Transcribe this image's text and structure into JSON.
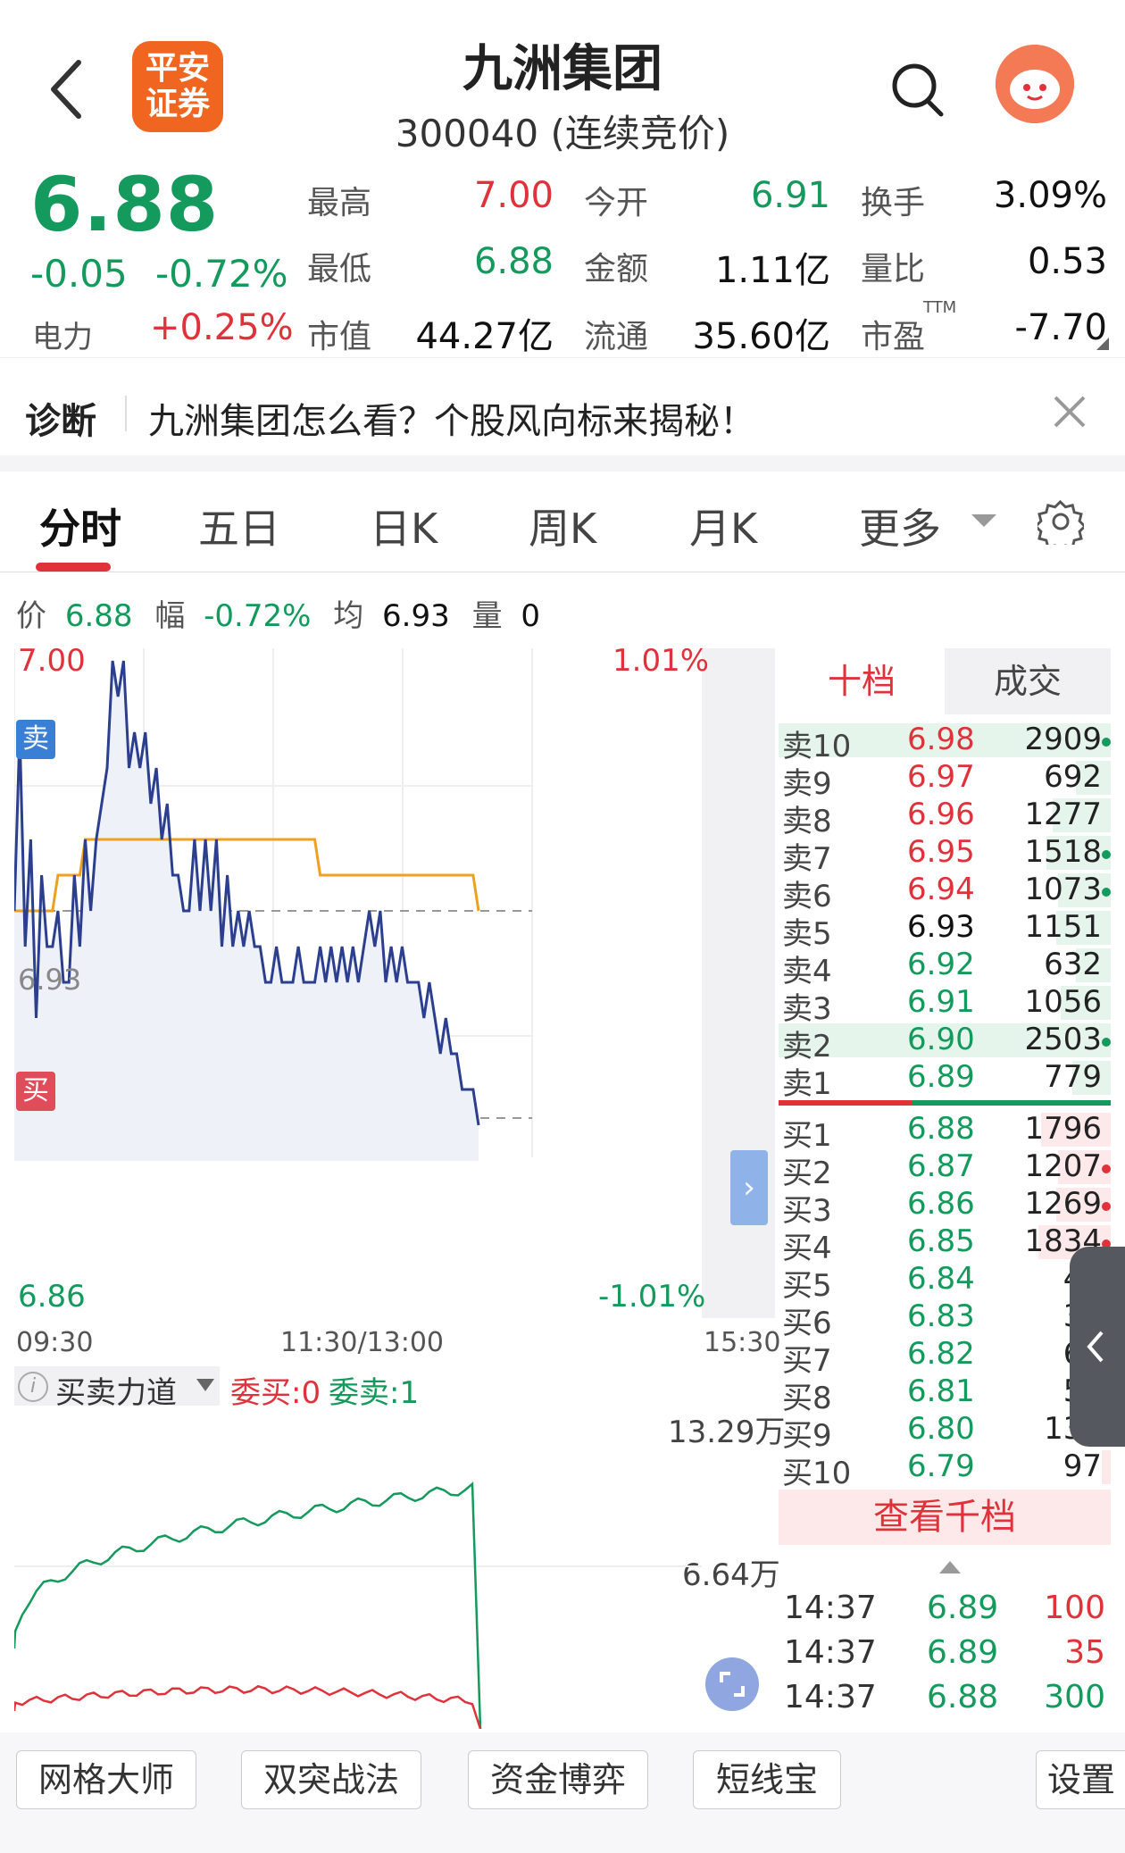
{
  "header": {
    "title": "九洲集团",
    "subtitle": "300040 (连续竞价)",
    "logo_text_line1": "平安",
    "logo_text_line2": "证券"
  },
  "quote": {
    "price": "6.88",
    "change": "-0.05",
    "change_pct": "-0.72%",
    "sector_label": "电力",
    "sector_pct": "+0.25%",
    "fields": [
      {
        "label": "最高",
        "value": "7.00"
      },
      {
        "label": "今开",
        "value": "6.91"
      },
      {
        "label": "换手",
        "value": "3.09%"
      },
      {
        "label": "最低",
        "value": "6.88"
      },
      {
        "label": "金额",
        "value": "1.11亿"
      },
      {
        "label": "量比",
        "value": "0.53"
      },
      {
        "label": "市值",
        "value": "44.27亿"
      },
      {
        "label": "流通",
        "value": "35.60亿"
      },
      {
        "label": "市盈",
        "value": "-7.70"
      }
    ],
    "pe_superscript": "TTM"
  },
  "diagnosis": {
    "label": "诊断",
    "text": "九洲集团怎么看？个股风向标来揭秘！"
  },
  "tabs": [
    "分时",
    "五日",
    "日K",
    "周K",
    "月K",
    "更多"
  ],
  "chart_info": {
    "price_label": "价",
    "price": "6.88",
    "pct_label": "幅",
    "pct": "-0.72%",
    "avg_label": "均",
    "avg": "6.93",
    "vol_label": "量",
    "vol": "0"
  },
  "chart_labels": {
    "top_price": "7.00",
    "top_pct": "1.01%",
    "mid_price": "6.93",
    "bottom_price": "6.86",
    "bottom_pct": "-1.01%",
    "time_start": "09:30",
    "time_mid": "11:30/13:00",
    "time_end": "15:30",
    "sell_marker": "卖",
    "buy_marker": "买"
  },
  "chart_data": {
    "type": "line",
    "xlabel": "",
    "ylabel": "",
    "ylim": [
      6.86,
      7.0
    ],
    "series": [
      {
        "values": [
          6.93,
          6.98,
          6.92,
          6.95,
          6.9,
          6.94,
          6.92,
          6.92,
          6.93,
          6.91,
          6.91,
          6.94,
          6.92,
          6.95,
          6.93,
          6.95,
          6.96,
          6.97,
          7.0,
          6.99,
          7.0,
          6.97,
          6.98,
          6.97,
          6.98,
          6.96,
          6.97,
          6.95,
          6.96,
          6.94,
          6.94,
          6.93,
          6.93,
          6.95,
          6.93,
          6.95,
          6.93,
          6.95,
          6.92,
          6.94,
          6.92,
          6.93,
          6.92,
          6.93,
          6.92,
          6.92,
          6.91,
          6.91,
          6.92,
          6.91,
          6.91,
          6.91,
          6.92,
          6.91,
          6.91,
          6.91,
          6.92,
          6.91,
          6.92,
          6.91,
          6.92,
          6.91,
          6.92,
          6.91,
          6.92,
          6.93,
          6.92,
          6.93,
          6.91,
          6.92,
          6.91,
          6.92,
          6.91,
          6.91,
          6.91,
          6.9,
          6.91,
          6.9,
          6.89,
          6.9,
          6.89,
          6.89,
          6.88,
          6.88,
          6.88,
          6.87
        ]
      },
      {
        "values": [
          6.93,
          6.93,
          6.93,
          6.93,
          6.93,
          6.93,
          6.93,
          6.93,
          6.94,
          6.94,
          6.94,
          6.94,
          6.94,
          6.95,
          6.95,
          6.95,
          6.95,
          6.95,
          6.95,
          6.95,
          6.95,
          6.95,
          6.95,
          6.95,
          6.95,
          6.95,
          6.95,
          6.95,
          6.95,
          6.95,
          6.95,
          6.95,
          6.95,
          6.95,
          6.95,
          6.95,
          6.95,
          6.95,
          6.95,
          6.95,
          6.95,
          6.95,
          6.95,
          6.95,
          6.95,
          6.95,
          6.95,
          6.95,
          6.95,
          6.95,
          6.95,
          6.95,
          6.95,
          6.95,
          6.95,
          6.95,
          6.94,
          6.94,
          6.94,
          6.94,
          6.94,
          6.94,
          6.94,
          6.94,
          6.94,
          6.94,
          6.94,
          6.94,
          6.94,
          6.94,
          6.94,
          6.94,
          6.94,
          6.94,
          6.94,
          6.94,
          6.94,
          6.94,
          6.94,
          6.94,
          6.94,
          6.94,
          6.94,
          6.94,
          6.94,
          6.93
        ]
      }
    ]
  },
  "power_panel": {
    "title": "买卖力道",
    "wb_label": "委买:0",
    "ws_label": "委卖:1",
    "top_value": "13.29万",
    "mid_value": "6.64万"
  },
  "book_tabs": [
    "十档",
    "成交"
  ],
  "order_book": {
    "asks": [
      {
        "label": "卖10",
        "price": "6.98",
        "vol": "2909",
        "color": "#e0323a",
        "bar": 0.95,
        "dot": "#139a5c"
      },
      {
        "label": "卖9",
        "price": "6.97",
        "vol": "692",
        "color": "#e0323a",
        "bar": 0.3,
        "dot": ""
      },
      {
        "label": "卖8",
        "price": "6.96",
        "vol": "1277",
        "color": "#e0323a",
        "bar": 0.5,
        "dot": ""
      },
      {
        "label": "卖7",
        "price": "6.95",
        "vol": "1518",
        "color": "#e0323a",
        "bar": 0.55,
        "dot": "#139a5c"
      },
      {
        "label": "卖6",
        "price": "6.94",
        "vol": "1073",
        "color": "#e0323a",
        "bar": 0.45,
        "dot": "#139a5c"
      },
      {
        "label": "卖5",
        "price": "6.93",
        "vol": "1151",
        "color": "#111111",
        "bar": 0.47,
        "dot": ""
      },
      {
        "label": "卖4",
        "price": "6.92",
        "vol": "632",
        "color": "#139a5c",
        "bar": 0.3,
        "dot": ""
      },
      {
        "label": "卖3",
        "price": "6.91",
        "vol": "1056",
        "color": "#139a5c",
        "bar": 0.43,
        "dot": ""
      },
      {
        "label": "卖2",
        "price": "6.90",
        "vol": "2503",
        "color": "#139a5c",
        "bar": 0.9,
        "dot": "#139a5c"
      },
      {
        "label": "卖1",
        "price": "6.89",
        "vol": "779",
        "color": "#139a5c",
        "bar": 0.33,
        "dot": ""
      }
    ],
    "bids": [
      {
        "label": "买1",
        "price": "6.88",
        "vol": "1796",
        "color": "#139a5c",
        "bar": 0.6,
        "dot": ""
      },
      {
        "label": "买2",
        "price": "6.87",
        "vol": "1207",
        "color": "#139a5c",
        "bar": 0.45,
        "dot": "#e0323a"
      },
      {
        "label": "买3",
        "price": "6.86",
        "vol": "1269",
        "color": "#139a5c",
        "bar": 0.47,
        "dot": "#e0323a"
      },
      {
        "label": "买4",
        "price": "6.85",
        "vol": "1834",
        "color": "#139a5c",
        "bar": 0.62,
        "dot": "#e0323a"
      },
      {
        "label": "买5",
        "price": "6.84",
        "vol": "47",
        "color": "#139a5c",
        "bar": 0.05,
        "dot": ""
      },
      {
        "label": "买6",
        "price": "6.83",
        "vol": "35",
        "color": "#139a5c",
        "bar": 0.04,
        "dot": ""
      },
      {
        "label": "买7",
        "price": "6.82",
        "vol": "66",
        "color": "#139a5c",
        "bar": 0.06,
        "dot": ""
      },
      {
        "label": "买8",
        "price": "6.81",
        "vol": "53",
        "color": "#139a5c",
        "bar": 0.05,
        "dot": ""
      },
      {
        "label": "买9",
        "price": "6.80",
        "vol": "130",
        "color": "#139a5c",
        "bar": 0.12,
        "dot": ""
      },
      {
        "label": "买10",
        "price": "6.79",
        "vol": "97",
        "color": "#139a5c",
        "bar": 0.08,
        "dot": ""
      }
    ],
    "view_more": "查看千档"
  },
  "trades": [
    {
      "time": "14:37",
      "price": "6.89",
      "vol": "100",
      "vol_color": "#e0323a"
    },
    {
      "time": "14:37",
      "price": "6.89",
      "vol": "35",
      "vol_color": "#e0323a"
    },
    {
      "time": "14:37",
      "price": "6.88",
      "vol": "300",
      "vol_color": "#139a5c"
    }
  ],
  "bottom_buttons": [
    "网格大师",
    "双突战法",
    "资金博弈",
    "短线宝",
    "设置"
  ],
  "colors": {
    "up": "#e0323a",
    "down": "#139a5c",
    "price_line": "#2b3f8e",
    "avg_line": "#f0a020"
  }
}
